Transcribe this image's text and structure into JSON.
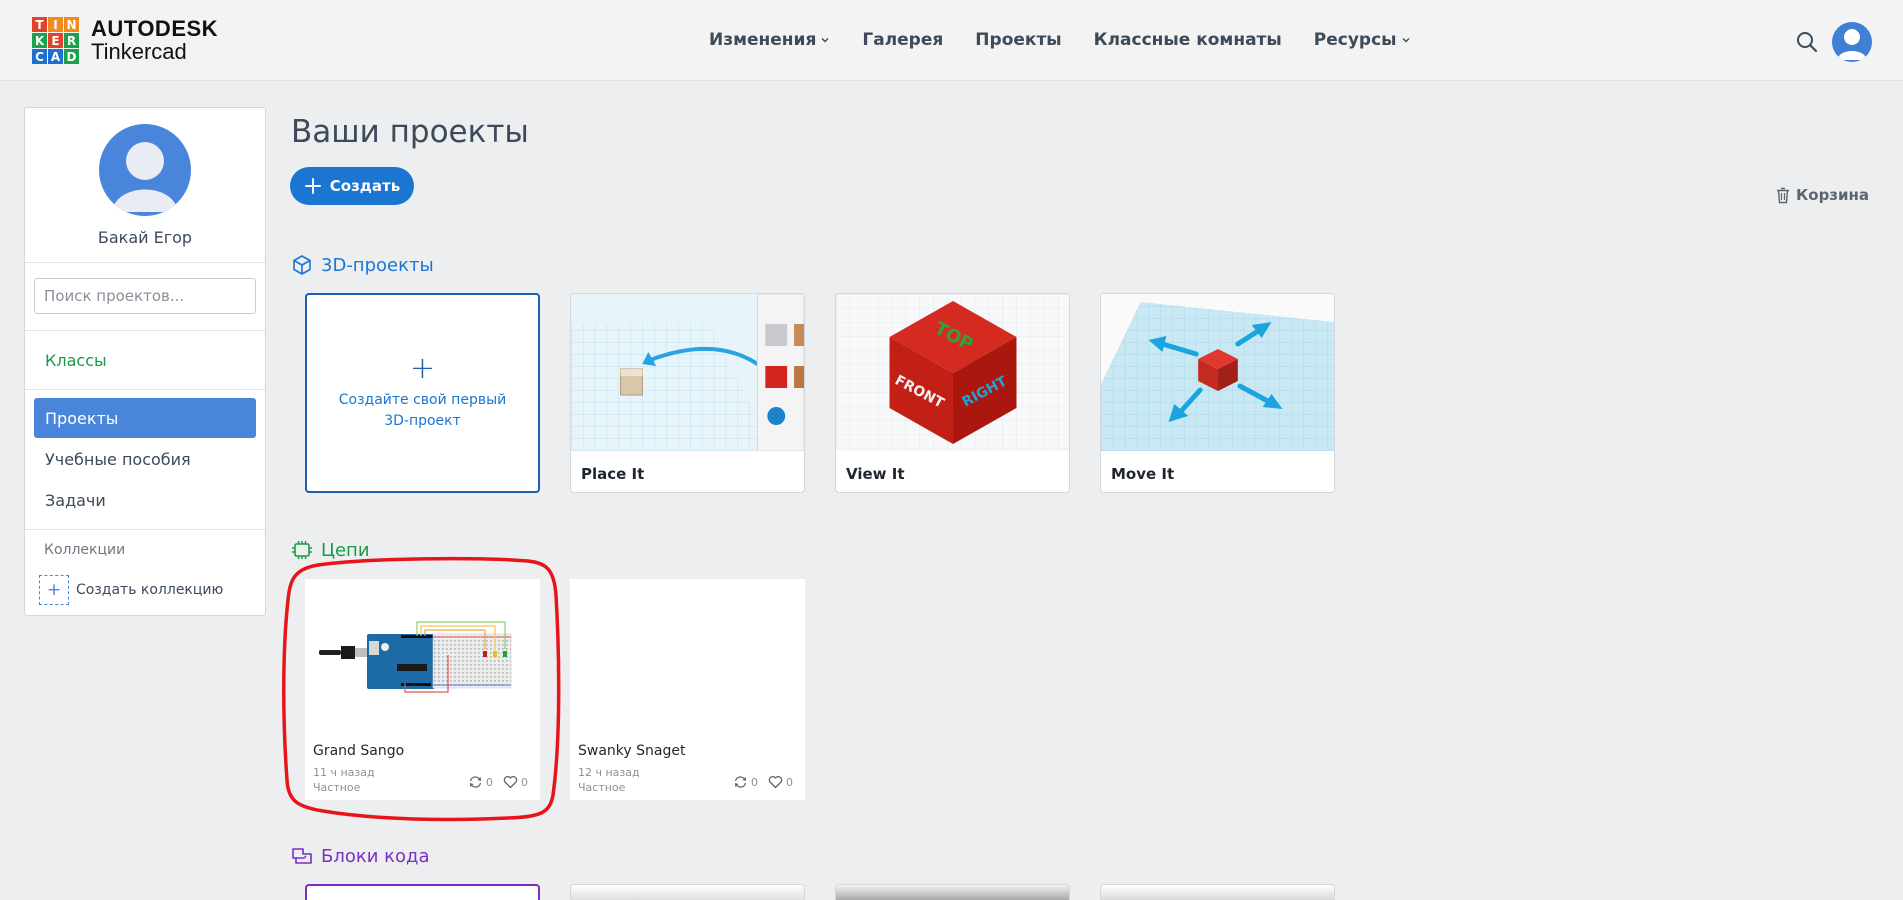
{
  "brand": {
    "letters": [
      "T",
      "I",
      "N",
      "K",
      "E",
      "R",
      "C",
      "A",
      "D"
    ],
    "letter_colors": [
      "#e2412c",
      "#f28b1e",
      "#f28b1e",
      "#1ba34b",
      "#e2412c",
      "#1ba34b",
      "#1e6fcf",
      "#1e6fcf",
      "#1ba34b"
    ],
    "name": "AUTODESK",
    "product": "Tinkercad"
  },
  "nav": {
    "items": [
      {
        "label": "Изменения",
        "dropdown": true
      },
      {
        "label": "Галерея",
        "dropdown": false
      },
      {
        "label": "Проекты",
        "dropdown": false
      },
      {
        "label": "Классные комнаты",
        "dropdown": false
      },
      {
        "label": "Ресурсы",
        "dropdown": true
      }
    ]
  },
  "sidebar": {
    "user_name": "Бакай Егор",
    "search_placeholder": "Поиск проектов...",
    "classes_label": "Классы",
    "items": [
      {
        "label": "Проекты",
        "active": true
      },
      {
        "label": "Учебные пособия",
        "active": false
      },
      {
        "label": "Задачи",
        "active": false
      }
    ],
    "collections_label": "Коллекции",
    "create_collection_label": "Создать коллекцию"
  },
  "main": {
    "title": "Ваши проекты",
    "create_label": "Создать",
    "trash_label": "Корзина",
    "sections": {
      "designs": {
        "title": "3D-проекты",
        "color": "#1b76d2",
        "new_card_text": "Создайте свой первый 3D-проект",
        "cards": [
          {
            "caption": "Place It"
          },
          {
            "caption": "View It"
          },
          {
            "caption": "Move It"
          }
        ],
        "cube_labels": {
          "top": "TOP",
          "front": "FRONT",
          "right": "RIGHT"
        }
      },
      "circuits": {
        "title": "Цепи",
        "color": "#1c9a48",
        "cards": [
          {
            "name": "Grand Sango",
            "time": "11 ч назад",
            "visibility": "Частное",
            "remixes": "0",
            "likes": "0"
          },
          {
            "name": "Swanky Snaget",
            "time": "12 ч назад",
            "visibility": "Частное",
            "remixes": "0",
            "likes": "0"
          }
        ]
      },
      "codeblocks": {
        "title": "Блоки кода",
        "color": "#7b2fc2"
      }
    }
  },
  "colors": {
    "accent": "#1b76d2",
    "sidebar_active": "#4a85dc",
    "annotation": "#e8141b"
  }
}
